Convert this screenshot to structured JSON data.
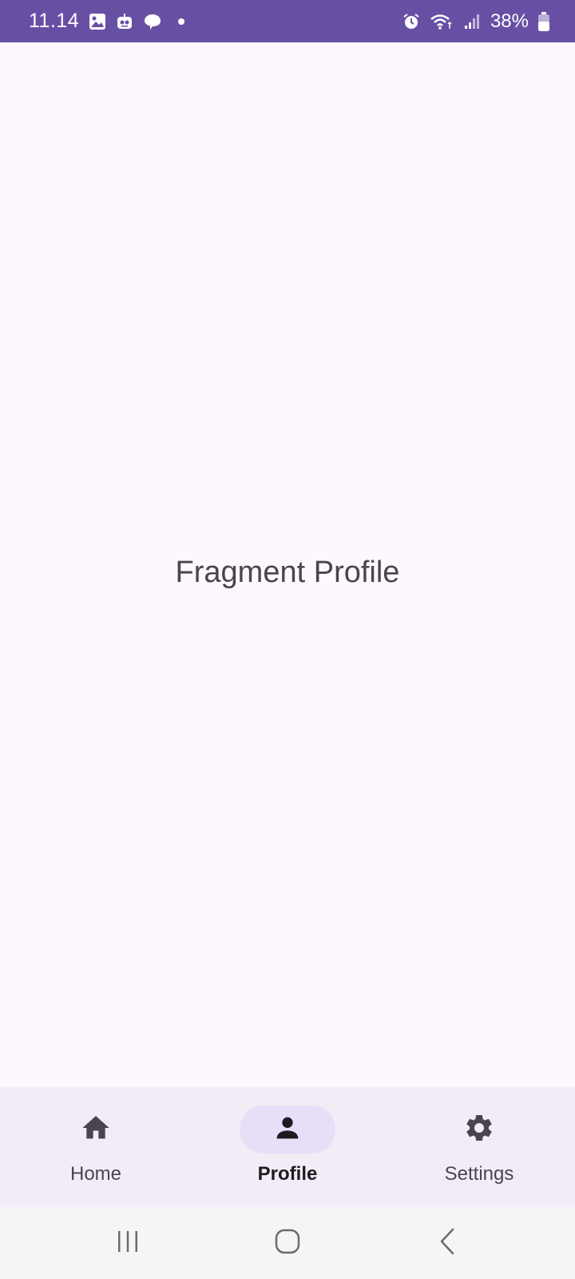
{
  "status_bar": {
    "time": "11.14",
    "battery": "38%",
    "background_color": "#6750a4",
    "left_icons": [
      "gallery-icon",
      "robot-icon",
      "chat-bubble-icon",
      "notification-dot-icon"
    ],
    "right_icons": [
      "alarm-icon",
      "wifi-icon",
      "signal-icon",
      "battery-icon"
    ]
  },
  "content": {
    "label": "Fragment Profile"
  },
  "bottom_nav": {
    "items": [
      {
        "label": "Home",
        "icon": "home-icon",
        "active": false
      },
      {
        "label": "Profile",
        "icon": "person-icon",
        "active": true
      },
      {
        "label": "Settings",
        "icon": "gear-icon",
        "active": false
      }
    ],
    "background_color": "#f2ecf6",
    "active_indicator_color": "#e8def8"
  },
  "system_nav": {
    "buttons": [
      "recents-icon",
      "home-circle-icon",
      "back-icon"
    ]
  }
}
